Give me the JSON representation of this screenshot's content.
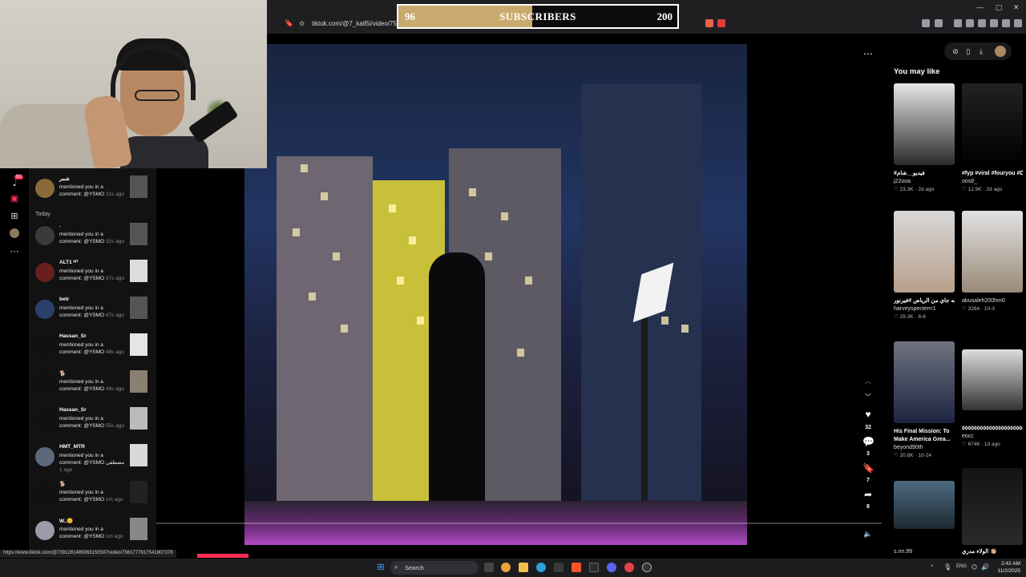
{
  "browser": {
    "address": "tiktok.com/@7_kall5i/video/75650",
    "status_url": "https://www.tiktok.com/@7391281489063150597/video/7561777817541807378"
  },
  "subscriber_bar": {
    "current": "96",
    "goal": "200",
    "label": "SUBSCRIBERS",
    "progress": 0.48,
    "fill_color": "#c9aa6e"
  },
  "nav": {
    "badge": "91",
    "icons": [
      "tiktok-logo-icon",
      "messages-icon",
      "upload-icon",
      "profile-icon",
      "more-icon"
    ]
  },
  "notifications": {
    "section_today": "Today",
    "items": [
      {
        "name": "شمر",
        "text": "mentioned you in a comment: @YSMO",
        "time": "31s ago"
      },
      {
        "name": ".",
        "text": "mentioned you in a comment: @YSMO",
        "time": "32s ago"
      },
      {
        "name": "ALT1 ᴹᵀ",
        "text": "mentioned you in a comment: @YSMO",
        "time": "37s ago"
      },
      {
        "name": "betr",
        "text": "mentioned you in a comment: @YSMO",
        "time": "47s ago"
      },
      {
        "name": "Hassan_Sr",
        "text": "mentioned you in a comment: @YSMO",
        "time": "48s ago"
      },
      {
        "name": "🐕",
        "text": "mentioned you in a comment: @YSMO",
        "time": "48s ago"
      },
      {
        "name": "Hassan_Sr",
        "text": "mentioned you in a comment: @YSMO",
        "time": "55s ago"
      },
      {
        "name": "HMT_MTR",
        "text": "mentioned you in a comment: @YSMO مصطفى",
        "time": "1 ago"
      },
      {
        "name": "🐕",
        "text": "mentioned you in a comment: @YSMO",
        "time": "1m ago"
      },
      {
        "name": "W..😊",
        "text": "mentioned you in a comment: @YSMO",
        "time": "1m ago"
      }
    ]
  },
  "video_actions": {
    "likes": "32",
    "comments": "3",
    "saves": "7",
    "shares": "8"
  },
  "recommendations": {
    "title": "You may like",
    "cards": [
      {
        "caption": "#فيديو__شام",
        "user": "j22ooa",
        "views": "23.3K",
        "age": "2d ago"
      },
      {
        "caption": "#fyp #viral #fouryou #Dexter...",
        "user": "oos8_",
        "views": "12.9K",
        "age": "2d ago"
      },
      {
        "caption": "أنا جاي من بعيد درا عشانه جاي من الرياض #فيرنور",
        "user": "harveyspecterrr1",
        "views": "29.3K",
        "age": "8-6"
      },
      {
        "caption": "",
        "user": "abusaleh200hm0",
        "views": "3264",
        "age": "10-3"
      },
      {
        "caption": "His Final Mission: To Make America Grea...",
        "user": "beyond90th",
        "views": "20.8K",
        "age": "10-24"
      },
      {
        "caption": "٥٥٥٥٥٥٥٥٥٥٥٥٥٥٥٥٥٥٥٥٥٥٥٥٥٥٥٥٥٥",
        "user": "eocc",
        "views": "6746",
        "age": "1d ago"
      },
      {
        "caption": "",
        "user": "s.nn.99",
        "views": "",
        "age": ""
      },
      {
        "caption": "الولاء مدري 👏🏼",
        "user": "",
        "views": "",
        "age": ""
      }
    ]
  },
  "taskbar": {
    "search_placeholder": "Search",
    "lang": "ENG",
    "time": "2:42 AM",
    "date": "11/2/2025"
  },
  "colors": {
    "accent": "#fe2c55",
    "background": "#000000"
  }
}
